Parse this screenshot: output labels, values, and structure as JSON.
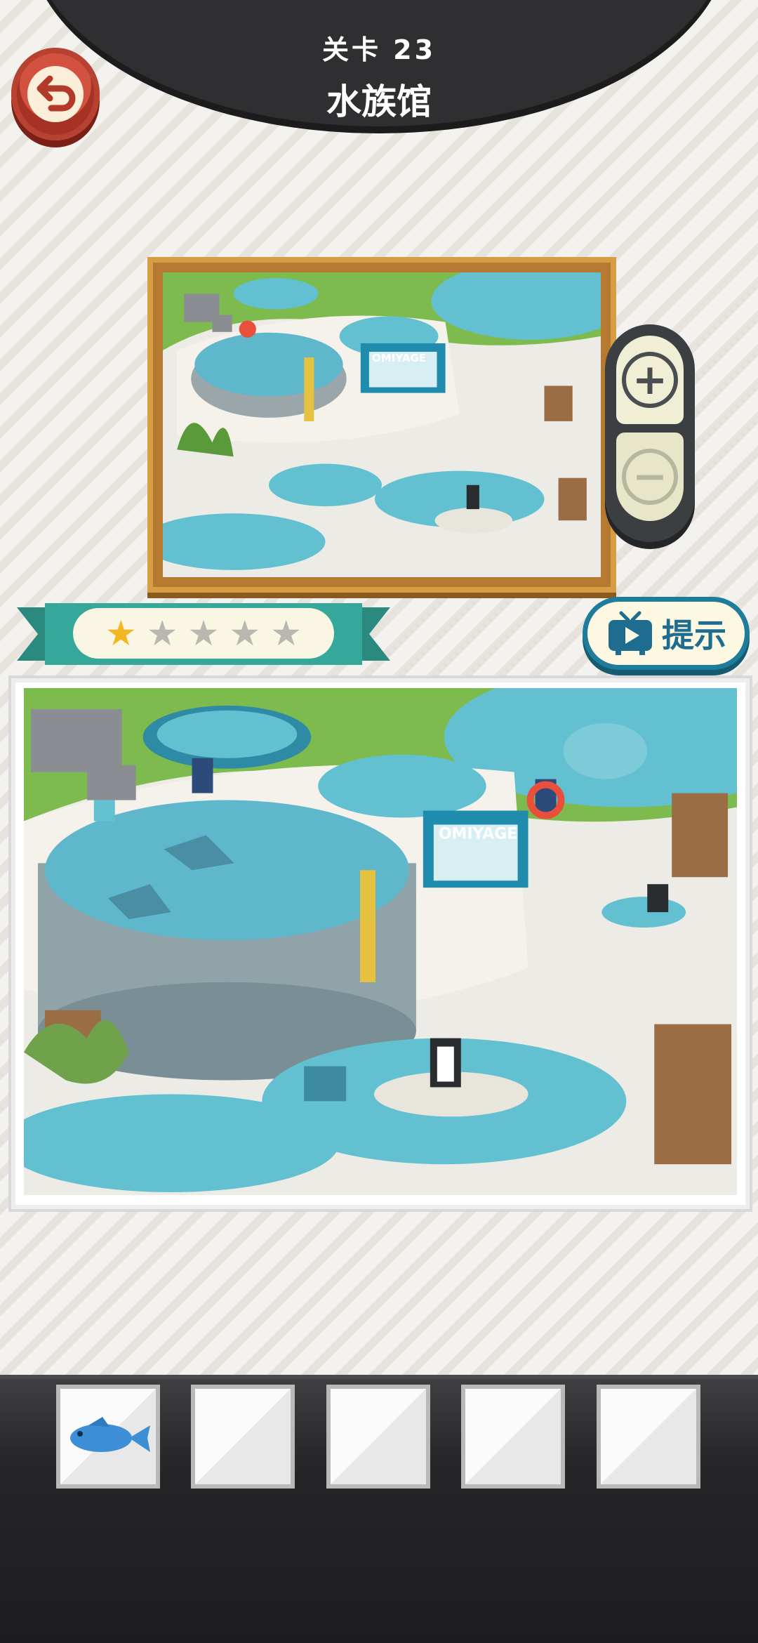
{
  "header": {
    "level_label": "关卡 23",
    "stage_name": "水族馆"
  },
  "back_button": {
    "icon": "back-arrow-icon"
  },
  "reference_picture": {
    "sign_text": "OMIYAGE"
  },
  "main_picture": {
    "sign_text": "OMIYAGE"
  },
  "zoom": {
    "zoom_in_icon": "plus-icon",
    "zoom_out_icon": "minus-icon"
  },
  "progress": {
    "stars_filled": 1,
    "stars_total": 5,
    "star_icons": [
      "★",
      "★",
      "★",
      "★",
      "★"
    ]
  },
  "hint_button": {
    "label": "提示",
    "icon": "tv-play-icon"
  },
  "inventory": {
    "slots": [
      {
        "item": "fish-icon"
      },
      {
        "item": ""
      },
      {
        "item": ""
      },
      {
        "item": ""
      },
      {
        "item": ""
      }
    ]
  },
  "colors": {
    "header": "#2f2f31",
    "back_button": "#d2523f",
    "ribbon": "#35a79b",
    "hint_button": "#1e7d9b",
    "star_filled": "#f4b722",
    "star_empty": "#b8b8b0",
    "water": "#6cc3d5"
  }
}
